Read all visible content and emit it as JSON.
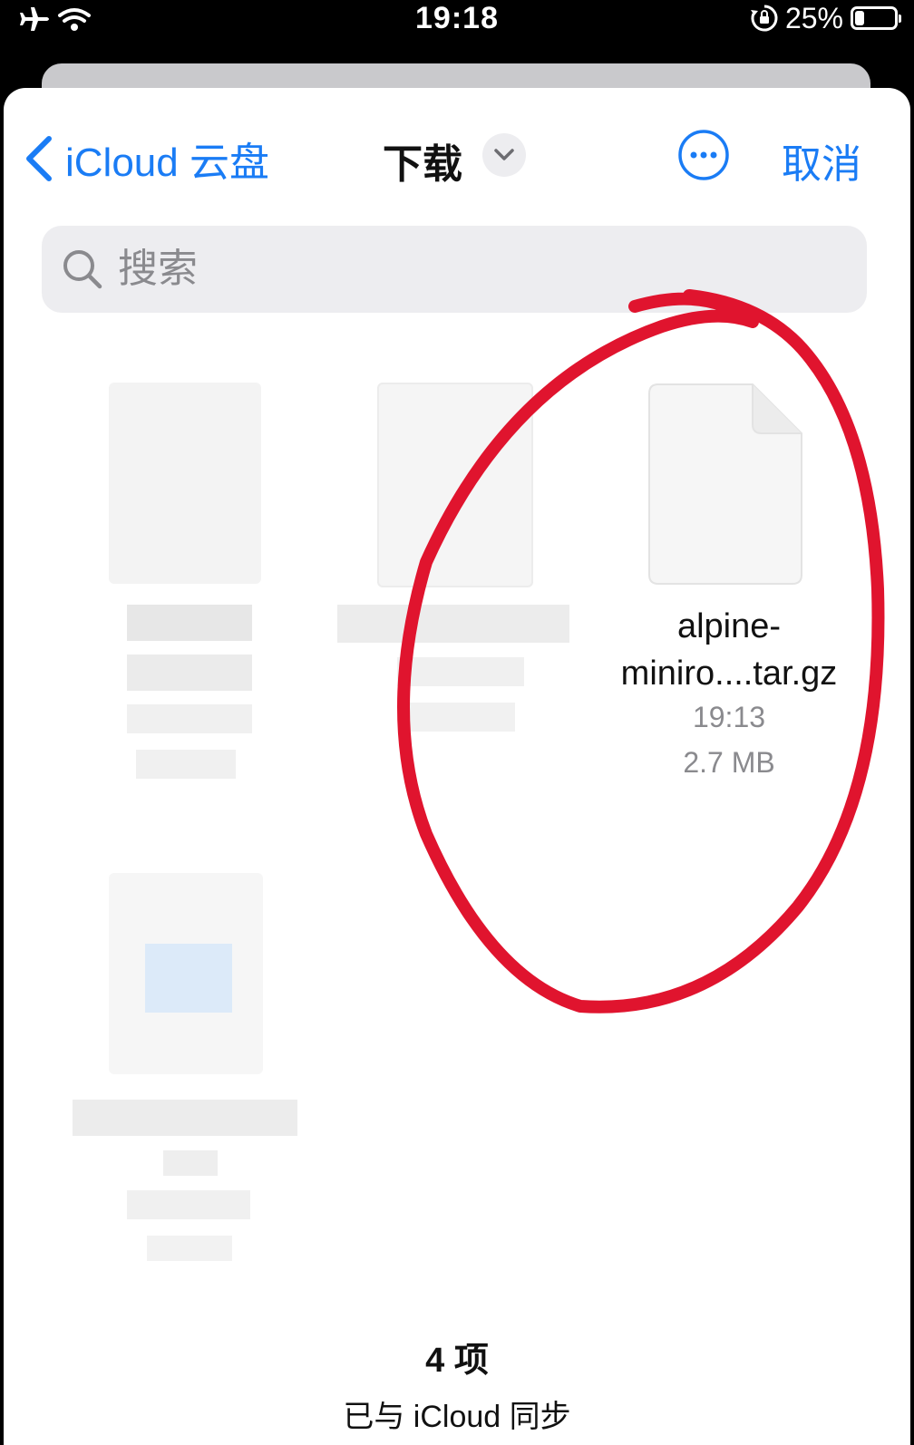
{
  "status_bar": {
    "time": "19:18",
    "battery_percent": "25%",
    "battery_level": 0.25,
    "icons": [
      "airplane-icon",
      "wifi-icon",
      "orientation-lock-icon",
      "battery-icon"
    ]
  },
  "nav": {
    "back_label": "iCloud 云盘",
    "title": "下载",
    "cancel_label": "取消"
  },
  "search": {
    "placeholder": "搜索"
  },
  "files": [
    {
      "name": "alpine-miniro....tar.gz",
      "name_line1": "alpine-",
      "name_line2": "miniro....tar.gz",
      "time": "19:13",
      "size": "2.7 MB",
      "icon": "document-icon"
    }
  ],
  "footer": {
    "count": "4 项",
    "sync_status": "已与 iCloud 同步"
  },
  "colors": {
    "accent": "#1a7cf5",
    "annotation": "#e0142e",
    "secondary_text": "#8a8a8e",
    "search_bg": "#ededf0"
  }
}
